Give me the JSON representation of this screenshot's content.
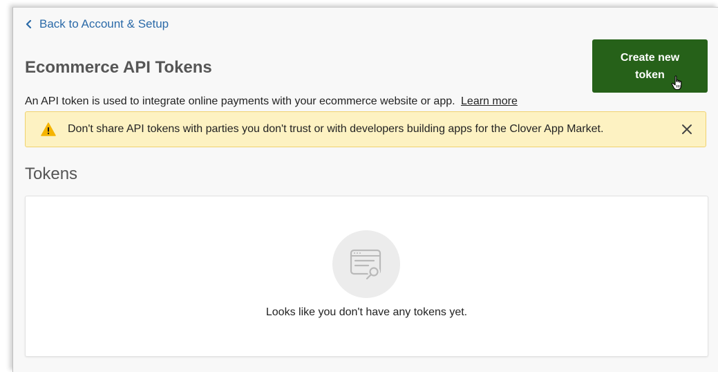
{
  "nav": {
    "back_label": "Back to Account & Setup"
  },
  "header": {
    "title": "Ecommerce API Tokens",
    "create_button_label": "Create new token"
  },
  "intro": {
    "description": "An API token is used to integrate online payments with your ecommerce website or app.",
    "learn_more": "Learn more"
  },
  "warning": {
    "message": "Don't share API tokens with parties you don't trust or with developers building apps for the Clover App Market.",
    "icon": "warning-triangle-icon",
    "close_icon": "close-icon"
  },
  "tokens": {
    "section_title": "Tokens",
    "empty_message": "Looks like you don't have any tokens yet.",
    "empty_icon": "api-token-icon"
  },
  "colors": {
    "primary_button": "#266119",
    "link": "#2b6aa8",
    "warning_bg": "#fdf2c2",
    "warning_border": "#f0d26f",
    "warning_icon": "#f5b400"
  }
}
